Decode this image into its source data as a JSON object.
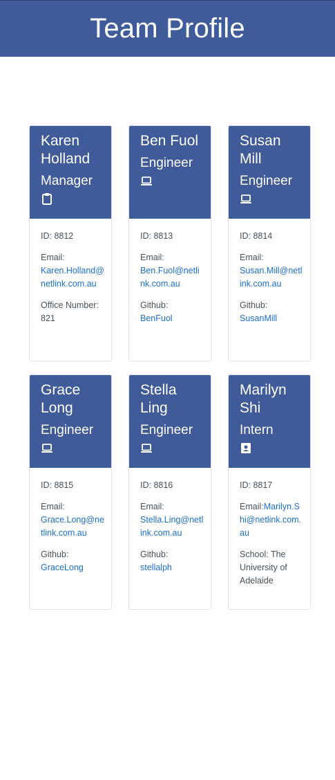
{
  "header": {
    "title": "Team Profile"
  },
  "colors": {
    "accent": "#3f5b99",
    "link": "#1a6fd1"
  },
  "team": [
    {
      "name": "Karen Holland",
      "role": "Manager",
      "icon": "clipboard-icon",
      "id": "ID: 8812",
      "email_label": "Email:",
      "email": "Karen.Holland@netlink.com.au",
      "extra_label": "Office Number:",
      "extra_value": "821"
    },
    {
      "name": "Ben Fuol",
      "role": "Engineer",
      "icon": "laptop-icon",
      "id": "ID: 8813",
      "email_label": "Email:",
      "email": "Ben.Fuol@netlink.com.au",
      "extra_label": "Github:",
      "extra_value": "BenFuol"
    },
    {
      "name": "Susan Mill",
      "role": "Engineer",
      "icon": "laptop-icon",
      "id": "ID: 8814",
      "email_label": "Email:",
      "email": "Susan.Mill@netlink.com.au",
      "extra_label": "Github:",
      "extra_value": "SusanMill"
    },
    {
      "name": "Grace Long",
      "role": "Engineer",
      "icon": "laptop-icon",
      "id": "ID: 8815",
      "email_label": "Email:",
      "email": "Grace.Long@netlink.com.au",
      "extra_label": "Github:",
      "extra_value": "GraceLong"
    },
    {
      "name": "Stella Ling",
      "role": "Engineer",
      "icon": "laptop-icon",
      "id": "ID: 8816",
      "email_label": "Email:",
      "email": "Stella.Ling@netlink.com.au",
      "extra_label": "Github:",
      "extra_value": "stellalph"
    },
    {
      "name": "Marilyn Shi",
      "role": "Intern",
      "icon": "id-badge-icon",
      "id": "ID: 8817",
      "email_label": "Email:",
      "email": "Marilyn.Shi@netlink.com.au",
      "extra_label": "School:",
      "extra_value": "The University of Adelaide"
    }
  ]
}
